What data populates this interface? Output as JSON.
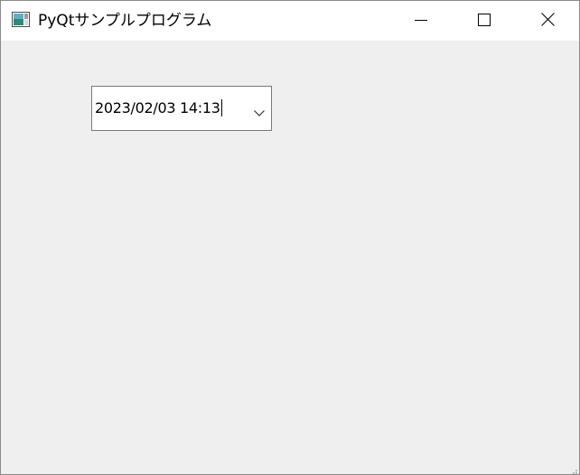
{
  "window": {
    "title": "PyQtサンプルプログラム",
    "icons": {
      "app": "app-window-icon",
      "minimize": "minimize-icon",
      "maximize": "maximize-icon",
      "close": "close-icon"
    }
  },
  "datetime_edit": {
    "value": "2023/02/03 14:13",
    "dropdown_icon": "chevron-down-icon"
  },
  "colors": {
    "titlebar_bg": "#ffffff",
    "client_bg": "#efefef",
    "field_border": "#7a7a7a"
  }
}
